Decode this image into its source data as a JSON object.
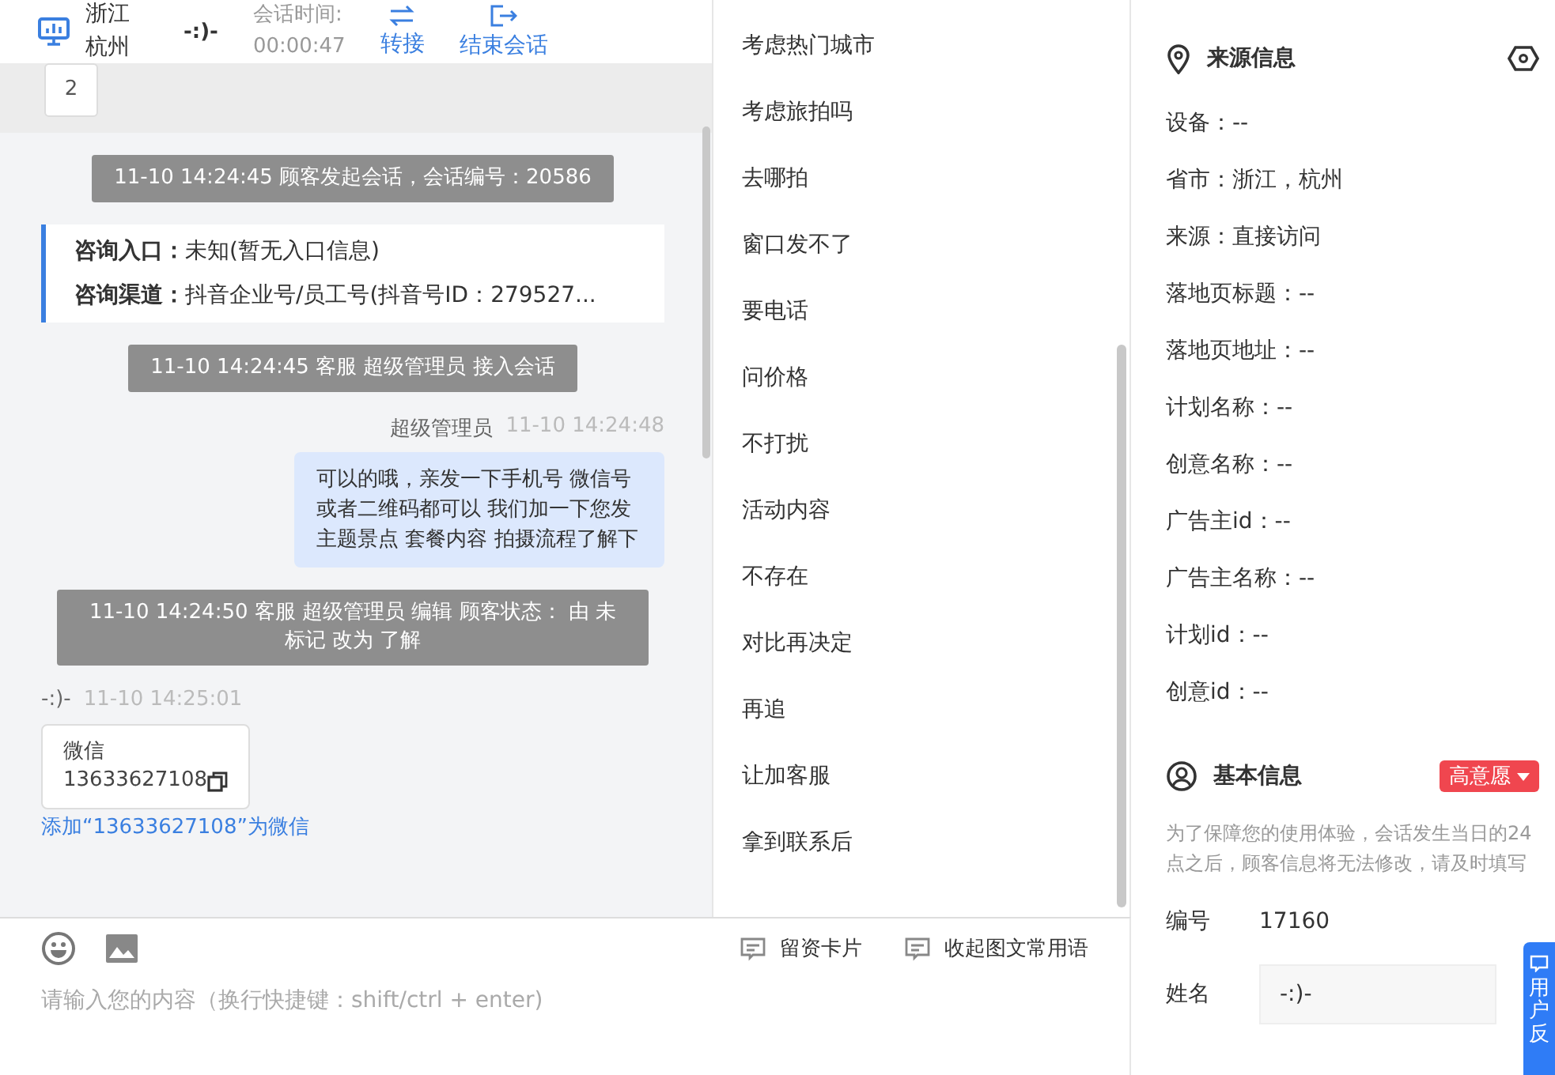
{
  "header": {
    "location": "浙江杭州",
    "customer": "-:)-",
    "timer_label": "会话时间:",
    "timer_value": "00:00:47",
    "actions": [
      {
        "label": "转接"
      },
      {
        "label": "结束会话"
      }
    ]
  },
  "messages": [
    {
      "kind": "counter",
      "text": "2"
    },
    {
      "kind": "system",
      "text": "11-10 14:24:45 顾客发起会话，会话编号：20586"
    },
    {
      "kind": "info",
      "lines": [
        {
          "label": "咨询入口：",
          "value": "未知(暂无入口信息)"
        },
        {
          "label": "咨询渠道：",
          "value": "抖音企业号/员工号(抖音号ID：279527..."
        }
      ]
    },
    {
      "kind": "system",
      "text": "11-10 14:24:45 客服 超级管理员 接入会话"
    },
    {
      "kind": "agent",
      "sender": "超级管理员",
      "time": "11-10 14:24:48",
      "text": "可以的哦，亲发一下手机号 微信号或者二维码都可以 我们加一下您发主题景点 套餐内容 拍摄流程了解下"
    },
    {
      "kind": "system",
      "text": "11-10 14:24:50 客服 超级管理员 编辑 顾客状态： 由 未标记 改为 了解"
    },
    {
      "kind": "customer",
      "sender": "-:)-",
      "time": "11-10 14:25:01",
      "card_title": "微信",
      "card_value": "13633627108",
      "link": "添加“13633627108”为微信"
    }
  ],
  "quick_replies": [
    "考虑热门城市",
    "考虑旅拍吗",
    "去哪拍",
    "窗口发不了",
    "要电话",
    "问价格",
    "不打扰",
    "活动内容",
    "不存在",
    "对比再决定",
    "再追",
    "让加客服",
    "拿到联系后"
  ],
  "composer": {
    "tools": [
      "留资卡片",
      "收起图文常用语"
    ],
    "placeholder": "请输入您的内容（换行快捷键：shift/ctrl + enter)"
  },
  "source_info": {
    "title": "来源信息",
    "fields": [
      "设备：--",
      "省市：浙江，杭州",
      "来源：直接访问",
      "落地页标题：--",
      "落地页地址：--",
      "计划名称：--",
      "创意名称：--",
      "广告主id：--",
      "广告主名称：--",
      "计划id：--",
      "创意id：--"
    ]
  },
  "basic_info": {
    "title": "基本信息",
    "intent_tag": "高意愿",
    "note": "为了保障您的使用体验，会话发生当日的24点之后，顾客信息将无法修改，请及时填写",
    "number_label": "编号",
    "number_value": "17160",
    "name_label": "姓名",
    "name_value": "-:)-"
  },
  "feedback": {
    "label": "用户反"
  }
}
